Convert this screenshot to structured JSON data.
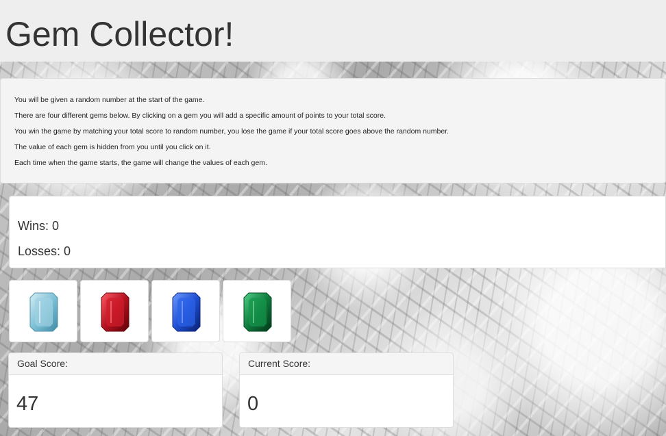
{
  "header": {
    "title": "Gem Collector!"
  },
  "instructions": [
    "You will be given a random number at the start of the game.",
    "There are four different gems below. By clicking on a gem you will add a specific amount of points to your total score.",
    "You win the game by matching your total score to random number, you lose the game if your total score goes above the random number.",
    "The value of each gem is hidden from you until you click on it.",
    "Each time when the game starts, the game will change the values of each gem."
  ],
  "record": {
    "wins": "Wins: 0",
    "losses": "Losses: 0"
  },
  "gems": [
    {
      "name": "aquamarine",
      "color": "#7fc1d6"
    },
    {
      "name": "ruby",
      "color": "#b3131f"
    },
    {
      "name": "sapphire",
      "color": "#1f4fd1"
    },
    {
      "name": "emerald",
      "color": "#0f7a3c"
    }
  ],
  "scores": {
    "goal_label": "Goal Score:",
    "goal_value": "47",
    "current_label": "Current Score:",
    "current_value": "0"
  }
}
